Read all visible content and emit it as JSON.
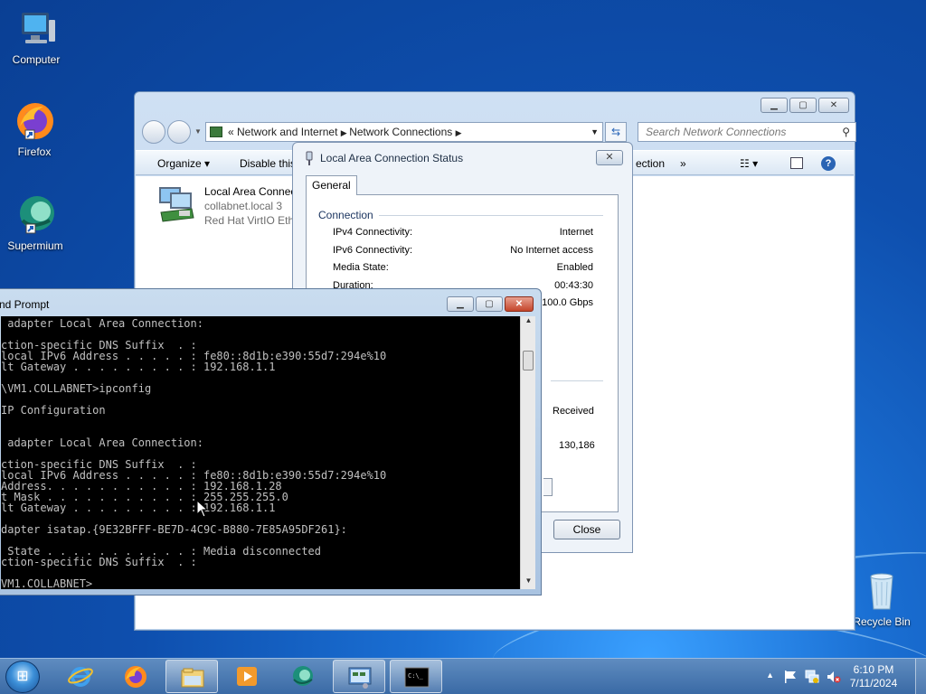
{
  "desktop": {
    "icons": [
      {
        "label": "Computer"
      },
      {
        "label": "Firefox"
      },
      {
        "label": "Supermium"
      },
      {
        "label": "Recycle Bin"
      }
    ]
  },
  "explorer": {
    "breadcrumb": [
      "Network and Internet",
      "Network Connections"
    ],
    "search_placeholder": "Search Network Connections",
    "toolbar": {
      "organize": "Organize",
      "disable": "Disable this",
      "partial_right": "ection",
      "more": "»"
    },
    "connection": {
      "name": "Local Area Connec",
      "network": "collabnet.local  3",
      "adapter": "Red Hat VirtIO Ethe"
    }
  },
  "status_dialog": {
    "title": "Local Area Connection Status",
    "tab": "General",
    "group": "Connection",
    "rows": [
      {
        "label": "IPv4 Connectivity:",
        "value": "Internet"
      },
      {
        "label": "IPv6 Connectivity:",
        "value": "No Internet access"
      },
      {
        "label": "Media State:",
        "value": "Enabled"
      },
      {
        "label": "Duration:",
        "value": "00:43:30"
      }
    ],
    "speed": "100.0 Gbps",
    "received_label": "Received",
    "received_value": "130,186",
    "close_label": "Close"
  },
  "cmd": {
    "title": "nd Prompt",
    "lines": [
      " adapter Local Area Connection:",
      "",
      "ction-specific DNS Suffix  . :",
      "local IPv6 Address . . . . . : fe80::8d1b:e390:55d7:294e%10",
      "lt Gateway . . . . . . . . . : 192.168.1.1",
      "",
      "\\VM1.COLLABNET>ipconfig",
      "",
      "IP Configuration",
      "",
      "",
      " adapter Local Area Connection:",
      "",
      "ction-specific DNS Suffix  . :",
      "local IPv6 Address . . . . . : fe80::8d1b:e390:55d7:294e%10",
      "Address. . . . . . . . . . . : 192.168.1.28",
      "t Mask . . . . . . . . . . . : 255.255.255.0",
      "lt Gateway . . . . . . . . . : 192.168.1.1",
      "",
      "dapter isatap.{9E32BFFF-BE7D-4C9C-B880-7E85A95DF261}:",
      "",
      " State . . . . . . . . . . . : Media disconnected",
      "ction-specific DNS Suffix  . :",
      "",
      "VM1.COLLABNET>"
    ]
  },
  "taskbar": {
    "time": "6:10 PM",
    "date": "7/11/2024"
  },
  "colors": {
    "desktop_blue": "#1a6fd3",
    "taskbar": "#3a6aa5",
    "cmd_background": "#000000",
    "cmd_text": "#c0c0c0"
  }
}
